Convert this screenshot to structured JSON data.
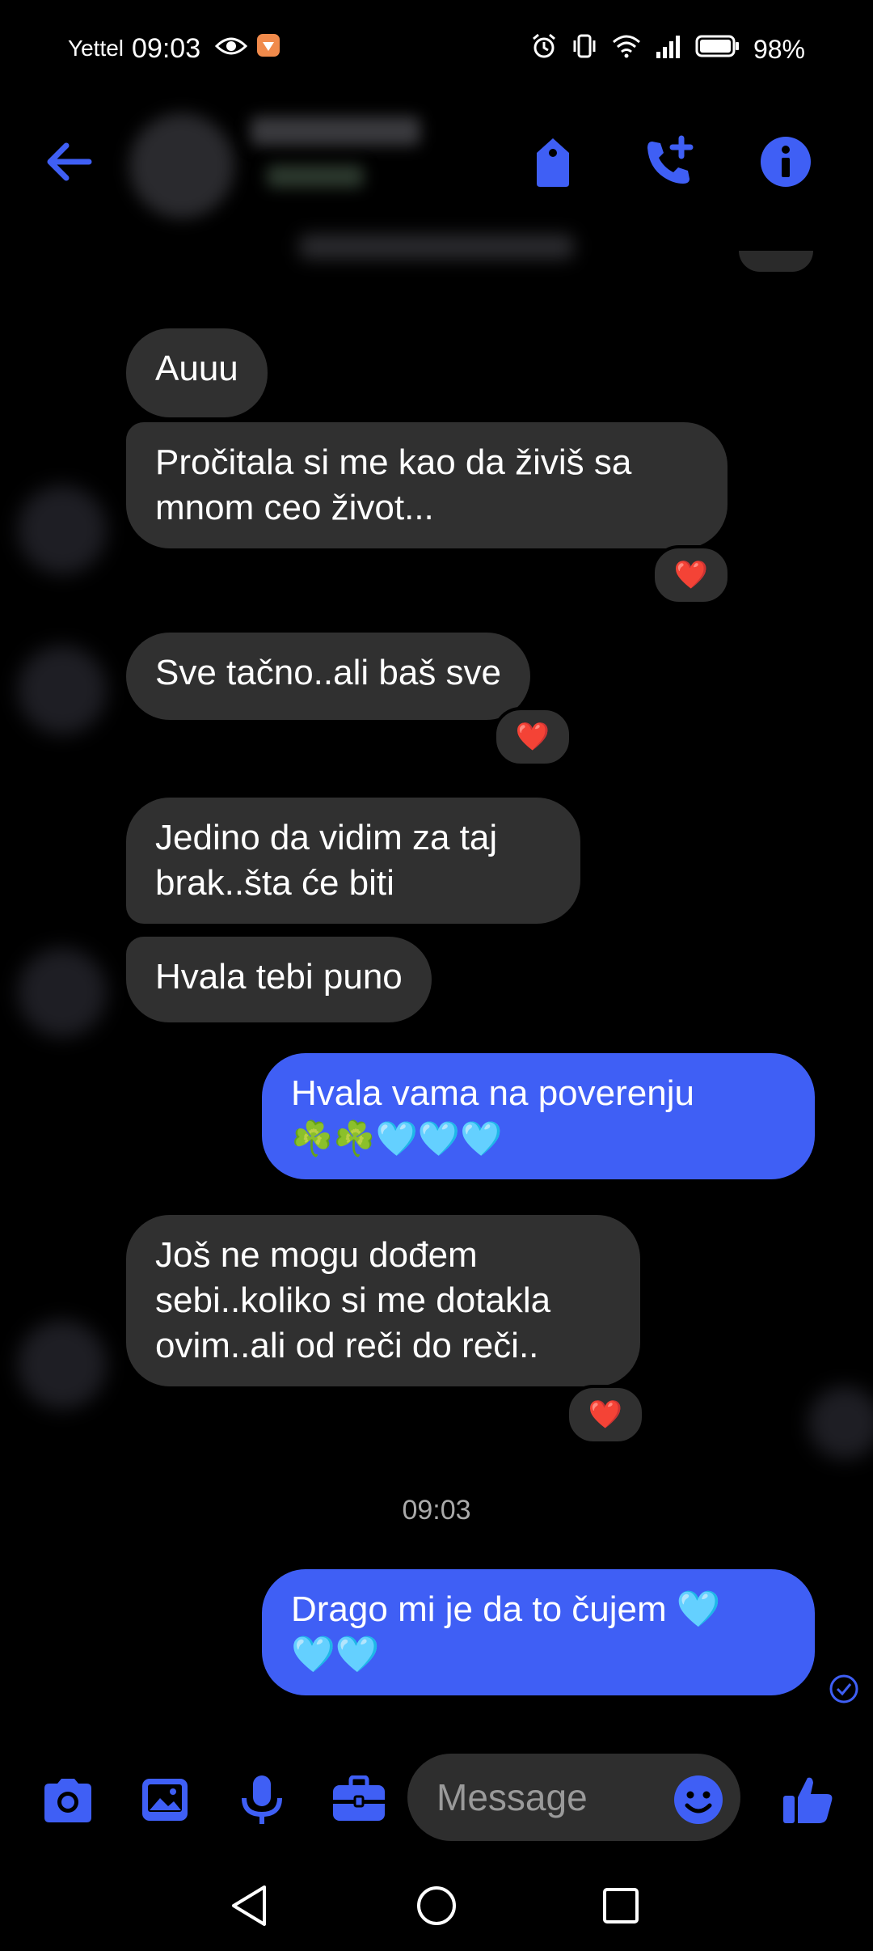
{
  "status_bar": {
    "carrier": "Yettel",
    "time": "09:03",
    "battery": "98%"
  },
  "header": {
    "accent": "#3f5ff5"
  },
  "messages": [
    {
      "id": "m1",
      "side": "in",
      "text": "Auuu"
    },
    {
      "id": "m2",
      "side": "in",
      "lines": [
        "Pročitala si me kao da živiš sa",
        "mnom ceo život..."
      ],
      "reaction": "❤️"
    },
    {
      "id": "m3",
      "side": "in",
      "text": "Sve tačno..ali baš sve",
      "reaction": "❤️"
    },
    {
      "id": "m4",
      "side": "in",
      "lines": [
        "Jedino da vidim za taj",
        "brak..šta će biti"
      ]
    },
    {
      "id": "m5",
      "side": "in",
      "text": "Hvala tebi puno"
    },
    {
      "id": "m6",
      "side": "out",
      "lines": [
        "Hvala vama na poverenju",
        "☘️☘️🩵🩵🩵"
      ]
    },
    {
      "id": "m7",
      "side": "in",
      "lines": [
        "Još ne mogu dođem",
        "sebi..koliko si me dotakla",
        "ovim..ali od reči do reči.."
      ],
      "reaction": "❤️"
    },
    {
      "id": "m8",
      "side": "out",
      "lines": [
        "Drago mi je da to čujem 🩵",
        "🩵🩵"
      ]
    }
  ],
  "timestamp": "09:03",
  "composer": {
    "placeholder": "Message"
  },
  "icons": [
    "back-arrow-icon",
    "tag-icon",
    "add-call-icon",
    "info-icon",
    "camera-icon",
    "gallery-icon",
    "microphone-icon",
    "briefcase-icon",
    "emoji-icon",
    "thumbs-up-icon",
    "back-nav-icon",
    "home-nav-icon",
    "recents-nav-icon"
  ]
}
